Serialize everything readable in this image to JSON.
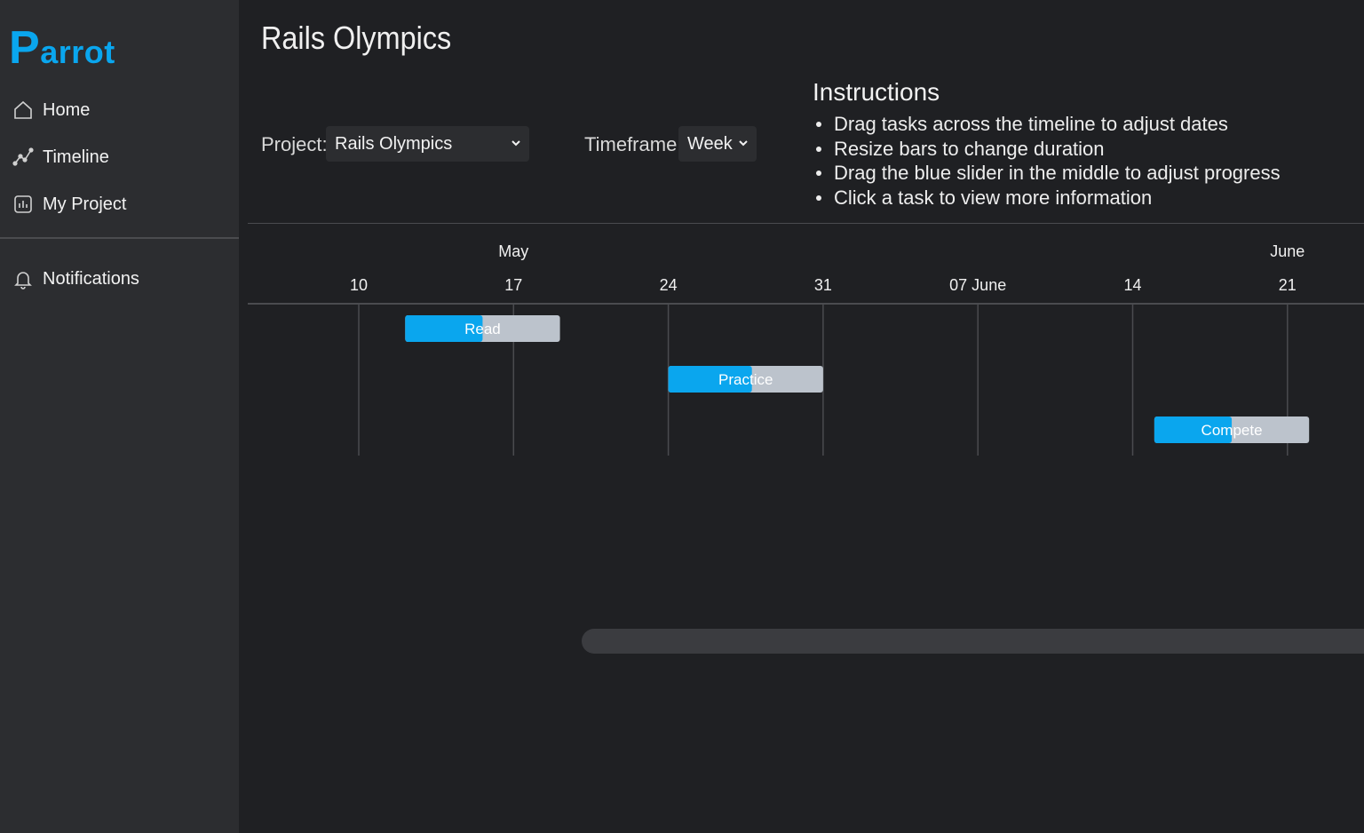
{
  "app": {
    "logo_first": "P",
    "logo_rest": "arrot",
    "brand_color": "#0aa6ee"
  },
  "sidebar": {
    "items": [
      {
        "label": "Home",
        "icon": "home-icon"
      },
      {
        "label": "Timeline",
        "icon": "timeline-icon"
      },
      {
        "label": "My Project",
        "icon": "chart-icon"
      },
      {
        "label": "Notifications",
        "icon": "bell-icon"
      }
    ]
  },
  "main": {
    "title": "Rails Olympics",
    "project_label": "Project:",
    "project_value": "Rails Olympics",
    "timeframe_label": "Timeframe:",
    "timeframe_value": "Week"
  },
  "instructions": {
    "title": "Instructions",
    "items": [
      "Drag tasks across the timeline to adjust dates",
      "Resize bars to change duration",
      "Drag the blue slider in the middle to adjust progress",
      "Click a task to view more information"
    ]
  },
  "gantt": {
    "months": [
      {
        "label": "May",
        "tick": "17"
      },
      {
        "label": "June",
        "tick": "21"
      }
    ],
    "ticks": [
      "10",
      "17",
      "24",
      "31",
      "07 June",
      "14",
      "21"
    ],
    "tasks": [
      {
        "name": "Read",
        "start_tick": 0.3,
        "end_tick": 1.3,
        "progress": 0.5
      },
      {
        "name": "Practice",
        "start_tick": 2.0,
        "end_tick": 3.0,
        "progress": 0.54
      },
      {
        "name": "Compete",
        "start_tick": 5.14,
        "end_tick": 6.14,
        "progress": 0.5
      }
    ],
    "progress_color": "#0aa6ee",
    "bar_color": "#bcc3cc"
  }
}
